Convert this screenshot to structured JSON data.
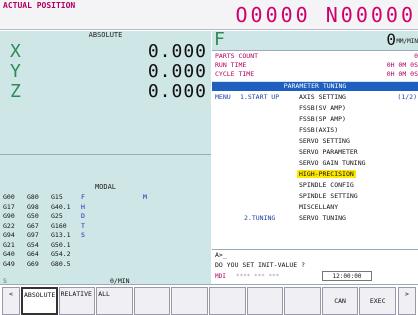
{
  "header": {
    "title": "ACTUAL POSITION",
    "program": "O0000 N00000"
  },
  "absolute": {
    "title": "ABSOLUTE",
    "axes": [
      {
        "name": "X",
        "value": "0.000"
      },
      {
        "name": "Y",
        "value": "0.000"
      },
      {
        "name": "Z",
        "value": "0.000"
      }
    ]
  },
  "modal": {
    "title": "MODAL",
    "lines": [
      [
        "G00",
        "G80",
        "G15",
        "F",
        "",
        "M"
      ],
      [
        "G17",
        "G98",
        "G40.1",
        "H",
        "",
        ""
      ],
      [
        "G90",
        "G50",
        "G25",
        "D",
        "",
        ""
      ],
      [
        "G22",
        "G67",
        "G160",
        "T",
        "",
        ""
      ],
      [
        "G94",
        "G97",
        "G13.1",
        "S",
        "",
        ""
      ],
      [
        "G21",
        "G54",
        "G50.1",
        "",
        "",
        ""
      ],
      [
        "G40",
        "G64",
        "G54.2",
        "",
        "",
        ""
      ],
      [
        "G49",
        "G69",
        "G80.5",
        "",
        "",
        ""
      ]
    ],
    "spindle_label": "S",
    "feed_unit": "0/MIN"
  },
  "feed": {
    "label": "F",
    "value": "0",
    "unit": "MM/MIN"
  },
  "counters": [
    {
      "label": "PARTS COUNT",
      "value": "0"
    },
    {
      "label": "RUN TIME",
      "value": "0H 0M 0S"
    },
    {
      "label": "CYCLE TIME",
      "value": "0H 0M 0S"
    }
  ],
  "menu": {
    "title": "PARAMETER TUNING",
    "menu_label": "MENU",
    "start_label": "1.START UP",
    "tuning_label": "2.TUNING",
    "page": "(1/2)",
    "start_items": [
      "AXIS SETTING",
      "FSSB(SV AMP)",
      "FSSB(SP AMP)",
      "FSSB(AXIS)",
      "SERVO SETTING",
      "SERVO PARAMETER",
      "SERVO GAIN TUNING",
      "HIGH-PRECISION",
      "SPINDLE CONFIG",
      "SPINDLE SETTING",
      "MISCELLANY"
    ],
    "selected_index": 7,
    "tuning_item": "SERVO TUNING"
  },
  "input": {
    "prompt": "A>_",
    "question": "DO YOU SET INIT-VALUE ?",
    "mode": "MDI",
    "stars": "**** *** ***",
    "time": "12:00:00"
  },
  "softkeys": {
    "left_arrow": "<",
    "right_arrow": ">",
    "keys": [
      "ABSOLUTE",
      "RELATIVE",
      "ALL",
      "",
      "",
      "",
      "",
      "",
      "CAN",
      "EXEC"
    ]
  },
  "colors": {
    "accent": "#d0006a",
    "panel": "#cfe6e6",
    "menu_header": "#1f5fc0",
    "highlight": "#ffe800",
    "axis_label": "#2e8b57"
  }
}
